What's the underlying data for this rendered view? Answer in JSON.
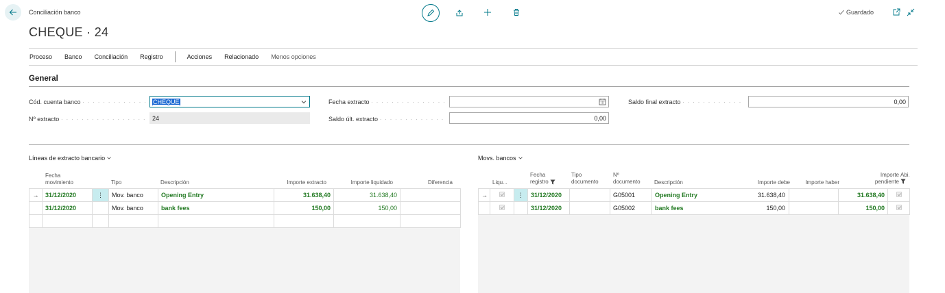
{
  "header": {
    "breadcrumb": "Conciliación banco",
    "title": "CHEQUE · 24",
    "saved_label": "Guardado"
  },
  "actions": {
    "primary": [
      "Proceso",
      "Banco",
      "Conciliación",
      "Registro"
    ],
    "secondary": [
      "Acciones",
      "Relacionado"
    ],
    "less_options": "Menos opciones"
  },
  "general": {
    "title": "General",
    "bank_account_label": "Cód. cuenta banco",
    "bank_account_value": "CHEQUE",
    "statement_no_label": "Nº extracto",
    "statement_no_value": "24",
    "statement_date_label": "Fecha extracto",
    "statement_date_value": "",
    "last_balance_label": "Saldo últ. extracto",
    "last_balance_value": "0,00",
    "ending_balance_label": "Saldo final extracto",
    "ending_balance_value": "0,00"
  },
  "statement_lines": {
    "title": "Líneas de extracto bancario",
    "headers": {
      "date_l1": "Fecha",
      "date_l2": "movimiento",
      "type": "Tipo",
      "description": "Descripción",
      "amount": "Importe extracto",
      "applied": "Importe liquidado",
      "difference": "Diferencia"
    },
    "rows": [
      {
        "date": "31/12/2020",
        "type": "Mov. banco",
        "description": "Opening Entry",
        "amount": "31.638,40",
        "applied": "31.638,40",
        "difference": ""
      },
      {
        "date": "31/12/2020",
        "type": "Mov. banco",
        "description": "bank fees",
        "amount": "150,00",
        "applied": "150,00",
        "difference": ""
      }
    ]
  },
  "bank_entries": {
    "title": "Movs. bancos",
    "headers": {
      "applied": "Liqu...",
      "posting_l1": "Fecha",
      "posting_l2": "registro",
      "doctype_l1": "Tipo",
      "doctype_l2": "documento",
      "docno_l1": "Nº",
      "docno_l2": "documento",
      "description": "Descripción",
      "debit": "Importe debe",
      "credit": "Importe haber",
      "remaining_l1": "Importe",
      "remaining_l2": "pendiente",
      "open": "Abi..."
    },
    "rows": [
      {
        "date": "31/12/2020",
        "doc_type": "",
        "doc_no": "G05001",
        "description": "Opening Entry",
        "debit": "31.638,40",
        "credit": "",
        "remaining": "31.638,40"
      },
      {
        "date": "31/12/2020",
        "doc_type": "",
        "doc_no": "G05002",
        "description": "bank fees",
        "debit": "150,00",
        "credit": "",
        "remaining": "150,00"
      }
    ]
  },
  "row_arrow": "→",
  "row_menu": "⋮",
  "icons": [
    "back-arrow-icon",
    "edit-pencil-icon",
    "share-icon",
    "plus-icon",
    "trash-icon",
    "check-icon",
    "open-new-window-icon",
    "collapse-icon",
    "calendar-icon",
    "chevron-down-icon",
    "filter-icon"
  ],
  "colors": {
    "accent": "#00788a",
    "green_text": "#237a23",
    "focus_select": "#1967d2"
  }
}
